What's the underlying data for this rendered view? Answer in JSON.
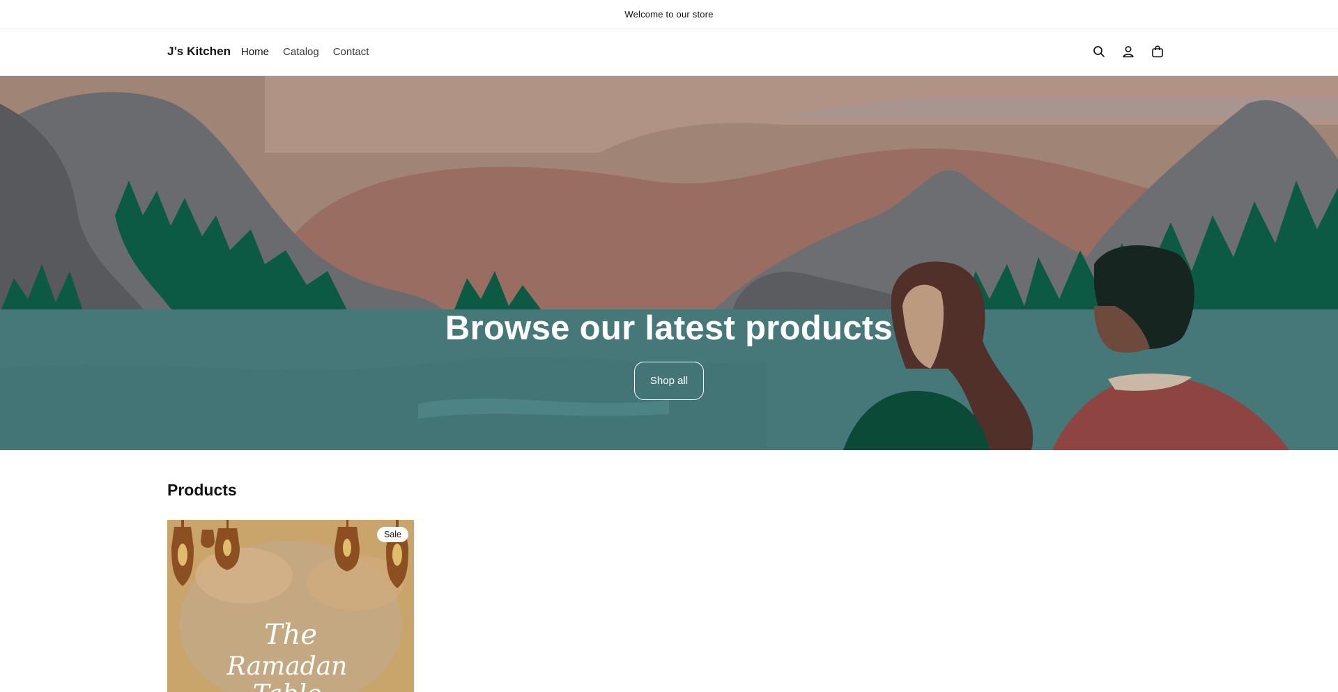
{
  "announcement": {
    "text": "Welcome to our store"
  },
  "header": {
    "brand": "J’s Kitchen",
    "nav": [
      {
        "label": "Home",
        "active": true
      },
      {
        "label": "Catalog",
        "active": false
      },
      {
        "label": "Contact",
        "active": false
      }
    ],
    "icons": [
      "search-icon",
      "account-icon",
      "cart-icon"
    ]
  },
  "hero": {
    "title": "Browse our latest products",
    "button_label": "Shop all"
  },
  "products": {
    "heading": "Products",
    "items": [
      {
        "badge": "Sale",
        "image_text_line1": "The",
        "image_text_line2": "Ramadan",
        "image_text_line3": "Table"
      }
    ]
  },
  "colors": {
    "water": "#46787a",
    "forest": "#0d5a44",
    "mountain": "#6a6b6e",
    "sky": "#a08576",
    "product_bg": "#c9a46b"
  }
}
